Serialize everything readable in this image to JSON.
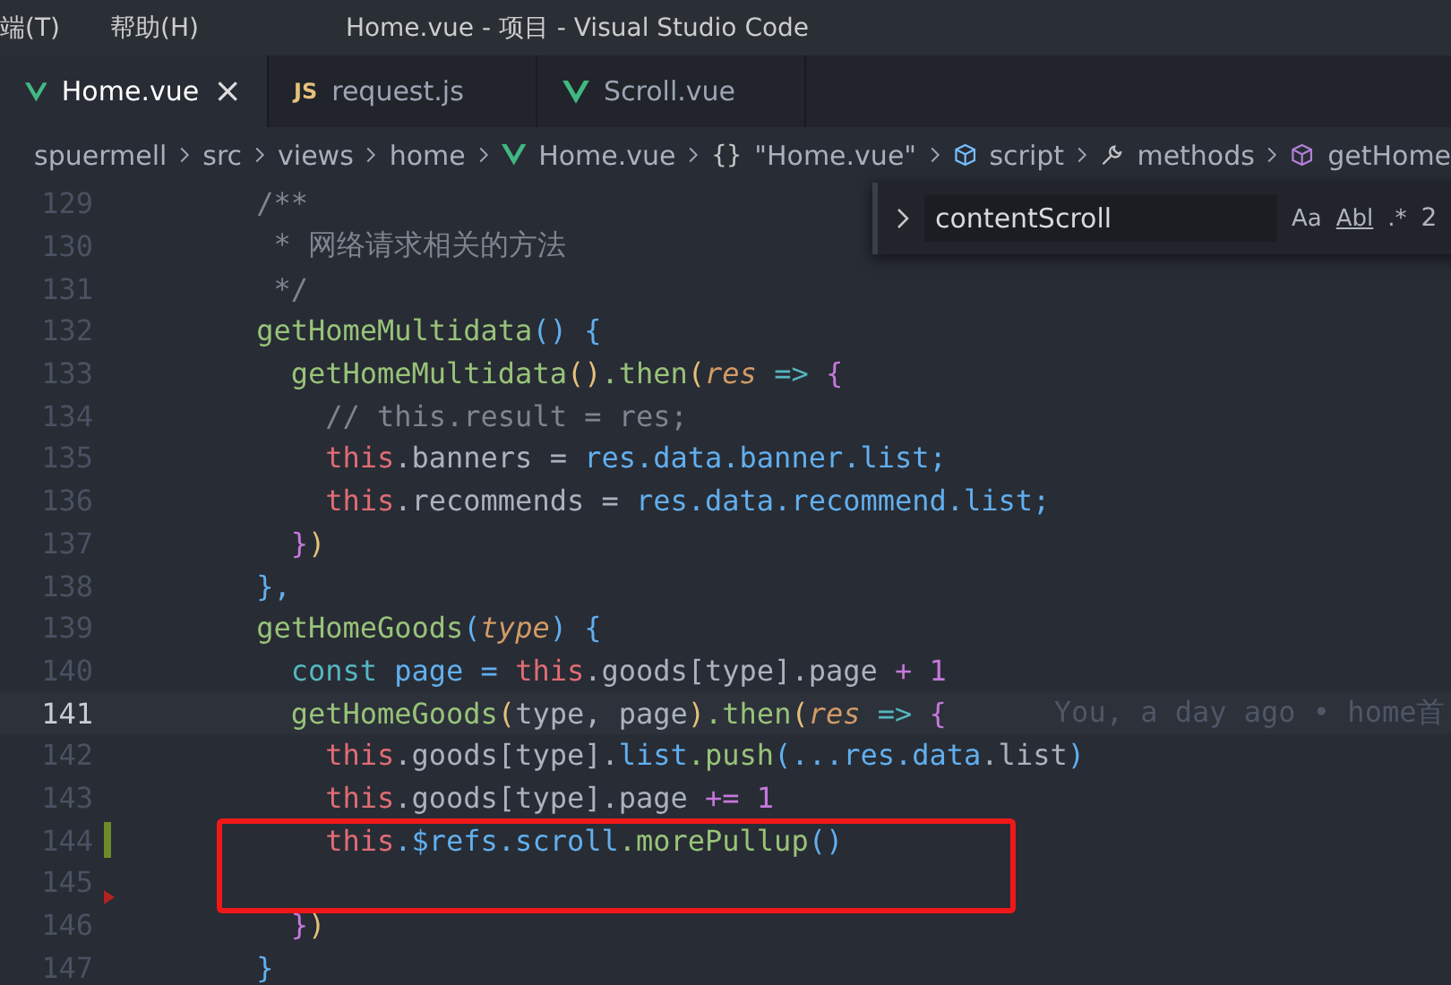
{
  "title_bar": {
    "menus": [
      "端(T)",
      "帮助(H)"
    ],
    "title": "Home.vue - 项目 - Visual Studio Code"
  },
  "tabs": [
    {
      "label": "Home.vue",
      "kind": "vue",
      "selected": true,
      "close": "×"
    },
    {
      "label": "request.js",
      "kind": "js",
      "icon_text": "JS",
      "selected": false
    },
    {
      "label": "Scroll.vue",
      "kind": "vue",
      "selected": false
    }
  ],
  "breadcrumb": [
    {
      "label": "spuermell",
      "kind": "folder"
    },
    {
      "label": "src",
      "kind": "folder"
    },
    {
      "label": "views",
      "kind": "folder"
    },
    {
      "label": "home",
      "kind": "folder"
    },
    {
      "label": "Home.vue",
      "kind": "vue"
    },
    {
      "label": "\"Home.vue\"",
      "kind": "braces",
      "icon_text": "{}"
    },
    {
      "label": "script",
      "kind": "cube"
    },
    {
      "label": "methods",
      "kind": "wrench"
    },
    {
      "label": "getHome",
      "kind": "method"
    }
  ],
  "find_widget": {
    "value": "contentScroll",
    "options": [
      "Aa",
      "Abl",
      ".*"
    ],
    "count": "2"
  },
  "blocks": [
    {
      "boxed": false,
      "lines": [
        {
          "number": "129",
          "current": false,
          "kind": "plain",
          "tokens": [
            {
              "text": "        /**",
              "kind": "comment"
            }
          ]
        },
        {
          "number": "130",
          "current": false,
          "kind": "plain",
          "tokens": [
            {
              "text": "         * 网络请求相关的方法",
              "kind": "comment"
            }
          ]
        },
        {
          "number": "131",
          "current": false,
          "kind": "plain",
          "tokens": [
            {
              "text": "         */",
              "kind": "comment"
            }
          ]
        },
        {
          "number": "132",
          "current": false,
          "kind": "plain",
          "tokens": [
            {
              "text": "        getHomeMultidata",
              "kind": "fn"
            },
            {
              "text": "() {",
              "kind": "b3"
            }
          ]
        },
        {
          "number": "133",
          "current": false,
          "kind": "plain",
          "tokens": [
            {
              "text": "          getHomeMultidata",
              "kind": "fn"
            },
            {
              "text": "()",
              "kind": "b1"
            },
            {
              "text": ".then",
              "kind": "fn"
            },
            {
              "text": "(",
              "kind": "b1"
            },
            {
              "text": "res",
              "kind": "param"
            },
            {
              "text": " => ",
              "kind": "op"
            },
            {
              "text": "{",
              "kind": "b2"
            }
          ]
        },
        {
          "number": "134",
          "current": false,
          "kind": "plain",
          "tokens": [
            {
              "text": "            // this.result = res;",
              "kind": "comment"
            }
          ]
        },
        {
          "number": "135",
          "current": false,
          "kind": "plain",
          "tokens": [
            {
              "text": "            this",
              "kind": "this"
            },
            {
              "text": ".banners = ",
              "kind": "plain"
            },
            {
              "text": "res.data.banner.list;",
              "kind": "prop"
            }
          ]
        },
        {
          "number": "136",
          "current": false,
          "kind": "plain",
          "tokens": [
            {
              "text": "            this",
              "kind": "this"
            },
            {
              "text": ".recommends = ",
              "kind": "plain"
            },
            {
              "text": "res.data.recommend.list;",
              "kind": "prop"
            }
          ]
        },
        {
          "number": "137",
          "current": false,
          "kind": "plain",
          "tokens": [
            {
              "text": "          }",
              "kind": "b2"
            },
            {
              "text": ")",
              "kind": "b1"
            }
          ]
        },
        {
          "number": "138",
          "current": false,
          "kind": "plain",
          "tokens": [
            {
              "text": "        },",
              "kind": "b3"
            }
          ]
        },
        {
          "number": "139",
          "current": false,
          "kind": "plain",
          "tokens": [
            {
              "text": "        getHomeGoods",
              "kind": "fn"
            },
            {
              "text": "(",
              "kind": "b3"
            },
            {
              "text": "type",
              "kind": "param"
            },
            {
              "text": ") {",
              "kind": "b3"
            }
          ]
        },
        {
          "number": "140",
          "current": false,
          "kind": "plain",
          "tokens": [
            {
              "text": "          const",
              "kind": "kw"
            },
            {
              "text": " page = ",
              "kind": "prop"
            },
            {
              "text": "this",
              "kind": "this"
            },
            {
              "text": ".goods[type].page",
              "kind": "plain"
            },
            {
              "text": " + 1",
              "kind": "num"
            }
          ]
        },
        {
          "number": "141",
          "current": true,
          "kind": "plain",
          "blame": "You, a day ago • home首",
          "tokens": [
            {
              "text": "          getHomeGoods",
              "kind": "fn"
            },
            {
              "text": "(",
              "kind": "b1"
            },
            {
              "text": "type, page",
              "kind": "plain"
            },
            {
              "text": ")",
              "kind": "b1"
            },
            {
              "text": ".then",
              "kind": "fn"
            },
            {
              "text": "(",
              "kind": "b1"
            },
            {
              "text": "res",
              "kind": "param"
            },
            {
              "text": " => ",
              "kind": "op"
            },
            {
              "text": "{",
              "kind": "b2"
            }
          ]
        },
        {
          "number": "142",
          "current": false,
          "kind": "plain",
          "tokens": [
            {
              "text": "            this",
              "kind": "this"
            },
            {
              "text": ".goods[type].",
              "kind": "plain"
            },
            {
              "text": "list",
              "kind": "prop"
            },
            {
              "text": ".push",
              "kind": "fn"
            },
            {
              "text": "(",
              "kind": "b3"
            },
            {
              "text": "...res.data",
              "kind": "prop"
            },
            {
              "text": ".list",
              "kind": "plain"
            },
            {
              "text": ")",
              "kind": "b3"
            }
          ]
        },
        {
          "number": "143",
          "current": false,
          "kind": "plain",
          "tokens": [
            {
              "text": "            this",
              "kind": "this"
            },
            {
              "text": ".goods[type].page",
              "kind": "plain"
            },
            {
              "text": " += 1",
              "kind": "num"
            }
          ]
        }
      ]
    },
    {
      "boxed": true,
      "lines": [
        {
          "number": "144",
          "current": false,
          "kind": "modified",
          "tokens": [
            {
              "text": "            this",
              "kind": "this"
            },
            {
              "text": ".$refs.scroll",
              "kind": "prop"
            },
            {
              "text": ".morePullup",
              "kind": "fn"
            },
            {
              "text": "()",
              "kind": "b3"
            }
          ]
        },
        {
          "number": "145",
          "current": false,
          "kind": "deleted"
        }
      ]
    },
    {
      "boxed": false,
      "lines": [
        {
          "number": "146",
          "current": false,
          "kind": "plain",
          "tokens": [
            {
              "text": "          }",
              "kind": "b2"
            },
            {
              "text": ")",
              "kind": "b1"
            }
          ]
        },
        {
          "number": "147",
          "current": false,
          "kind": "plain",
          "tokens": [
            {
              "text": "        }",
              "kind": "b3"
            }
          ]
        }
      ]
    }
  ]
}
